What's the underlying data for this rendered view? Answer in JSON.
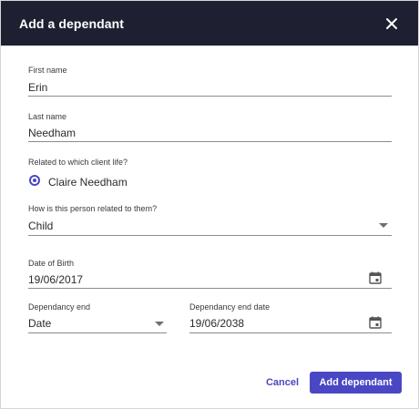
{
  "dialog": {
    "title": "Add a dependant",
    "close_icon": "close-icon"
  },
  "fields": {
    "first_name": {
      "label": "First name",
      "value": "Erin"
    },
    "last_name": {
      "label": "Last name",
      "value": "Needham"
    },
    "related_client": {
      "label": "Related to which client life?",
      "option": "Claire Needham",
      "selected": true
    },
    "relationship": {
      "label": "How is this person related to them?",
      "value": "Child"
    },
    "dob": {
      "label": "Date of Birth",
      "value": "19/06/2017",
      "icon": "calendar-icon"
    },
    "dependancy_end": {
      "label": "Dependancy end",
      "value": "Date"
    },
    "dependancy_end_date": {
      "label": "Dependancy end date",
      "value": "19/06/2038",
      "icon": "calendar-icon"
    }
  },
  "actions": {
    "cancel_label": "Cancel",
    "add_label": "Add dependant"
  },
  "colors": {
    "header_bg": "#1e2032",
    "accent": "#4a47c4"
  }
}
